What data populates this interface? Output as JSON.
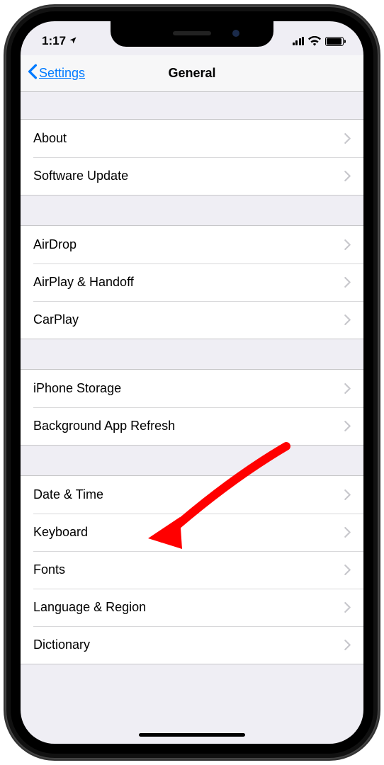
{
  "status": {
    "time": "1:17"
  },
  "nav": {
    "back_label": "Settings",
    "title": "General"
  },
  "groups": [
    {
      "items": [
        {
          "key": "about",
          "label": "About"
        },
        {
          "key": "software-update",
          "label": "Software Update"
        }
      ]
    },
    {
      "items": [
        {
          "key": "airdrop",
          "label": "AirDrop"
        },
        {
          "key": "airplay-handoff",
          "label": "AirPlay & Handoff"
        },
        {
          "key": "carplay",
          "label": "CarPlay"
        }
      ]
    },
    {
      "items": [
        {
          "key": "iphone-storage",
          "label": "iPhone Storage"
        },
        {
          "key": "background-app-refresh",
          "label": "Background App Refresh"
        }
      ]
    },
    {
      "items": [
        {
          "key": "date-time",
          "label": "Date & Time"
        },
        {
          "key": "keyboard",
          "label": "Keyboard"
        },
        {
          "key": "fonts",
          "label": "Fonts"
        },
        {
          "key": "language-region",
          "label": "Language & Region"
        },
        {
          "key": "dictionary",
          "label": "Dictionary"
        }
      ]
    }
  ],
  "annotation": {
    "arrow_color": "#ff0000",
    "points_to": "date-time"
  }
}
